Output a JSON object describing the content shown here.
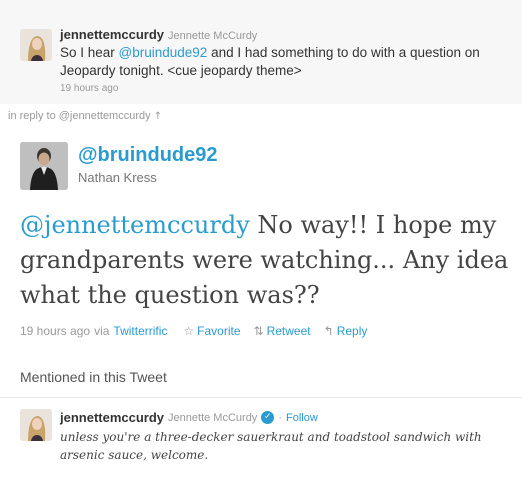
{
  "reply_to": {
    "screen_name": "jennettemccurdy",
    "full_name": "Jennette McCurdy",
    "text_before": "So I hear ",
    "mention": "@bruindude92",
    "text_after": " and I had something to do with a question on Jeopardy tonight. <cue jeopardy theme>",
    "time": "19 hours ago",
    "avatar_icon": "user-avatar-photo"
  },
  "in_reply_to": {
    "label": "in reply to @jennettemccurdy",
    "arrow": "↑"
  },
  "tweet": {
    "screen_name": "@bruindude92",
    "full_name": "Nathan Kress",
    "mention": "@jennettemccurdy",
    "text": " No way!! I hope my grandparents were watching... Any idea what the question was??",
    "time": "19 hours ago",
    "via": "via",
    "client": "Twitterrific",
    "actions": {
      "favorite": "Favorite",
      "retweet": "Retweet",
      "reply": "Reply"
    },
    "avatar_icon": "user-avatar-photo"
  },
  "mentioned": {
    "heading": "Mentioned in this Tweet",
    "user": {
      "screen_name": "jennettemccurdy",
      "full_name": "Jennette McCurdy",
      "separator": "·",
      "follow": "Follow",
      "bio": "unless you're a three-decker sauerkraut and toadstool sandwich with arsenic sauce, welcome.",
      "verified_icon": "verified-badge-icon"
    }
  },
  "colors": {
    "link": "#2a9bd1",
    "muted": "#999999",
    "reply_bg": "#f7f7f7"
  }
}
